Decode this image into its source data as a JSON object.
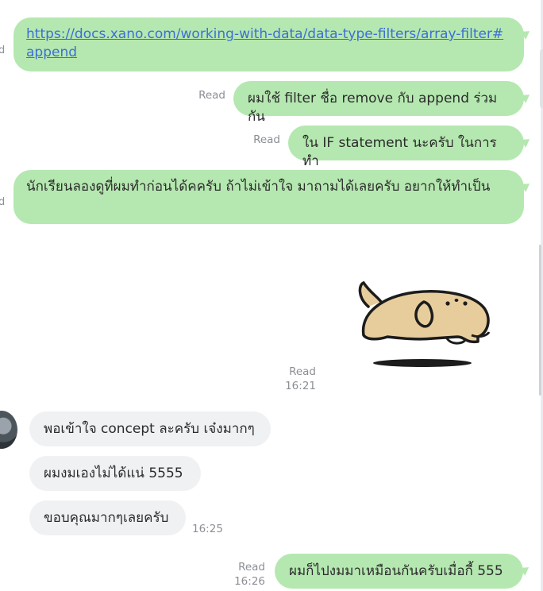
{
  "messages": [
    {
      "id": "m1",
      "side": "out",
      "text": "https://docs.xano.com/working-with-data/data-type-filters/array-filter#append",
      "is_link": true,
      "clipped_meta": "d"
    },
    {
      "id": "m2",
      "side": "out",
      "text": "ผมใช้ filter ชื่อ remove กับ append ร่วมกัน",
      "status": "Read"
    },
    {
      "id": "m3",
      "side": "out",
      "text": "ใน IF statement นะครับ ในการทำ",
      "status": "Read"
    },
    {
      "id": "m4",
      "side": "out",
      "text": "นักเรียนลองดูที่ผมทำก่อนได้คครับ ถ้าไม่เข้าใจ มาถามได้เลยครับ อยากให้ทำเป็น",
      "clipped_meta": "d"
    },
    {
      "id": "m5",
      "side": "out",
      "type": "sticker",
      "sticker_name": "sleepy-dog-sticker",
      "status": "Read",
      "time": "16:21"
    },
    {
      "id": "m6",
      "side": "in",
      "text": "พอเข้าใจ concept ละครับ เจ๋งมากๆ"
    },
    {
      "id": "m7",
      "side": "in",
      "text": "ผมงมเองไม่ได้แน่ 5555"
    },
    {
      "id": "m8",
      "side": "in",
      "text": "ขอบคุณมากๆเลยครับ",
      "time": "16:25"
    },
    {
      "id": "m9",
      "side": "out",
      "text": "ผมก็ไปงมมาเหมือนกันครับเมื่อกี้ 555",
      "status": "Read",
      "time": "16:26"
    }
  ],
  "colors": {
    "outgoing_bubble": "#b5e8b0",
    "incoming_bubble": "#f0f1f3",
    "link": "#3d6fd1",
    "meta_text": "#8b8f96"
  }
}
